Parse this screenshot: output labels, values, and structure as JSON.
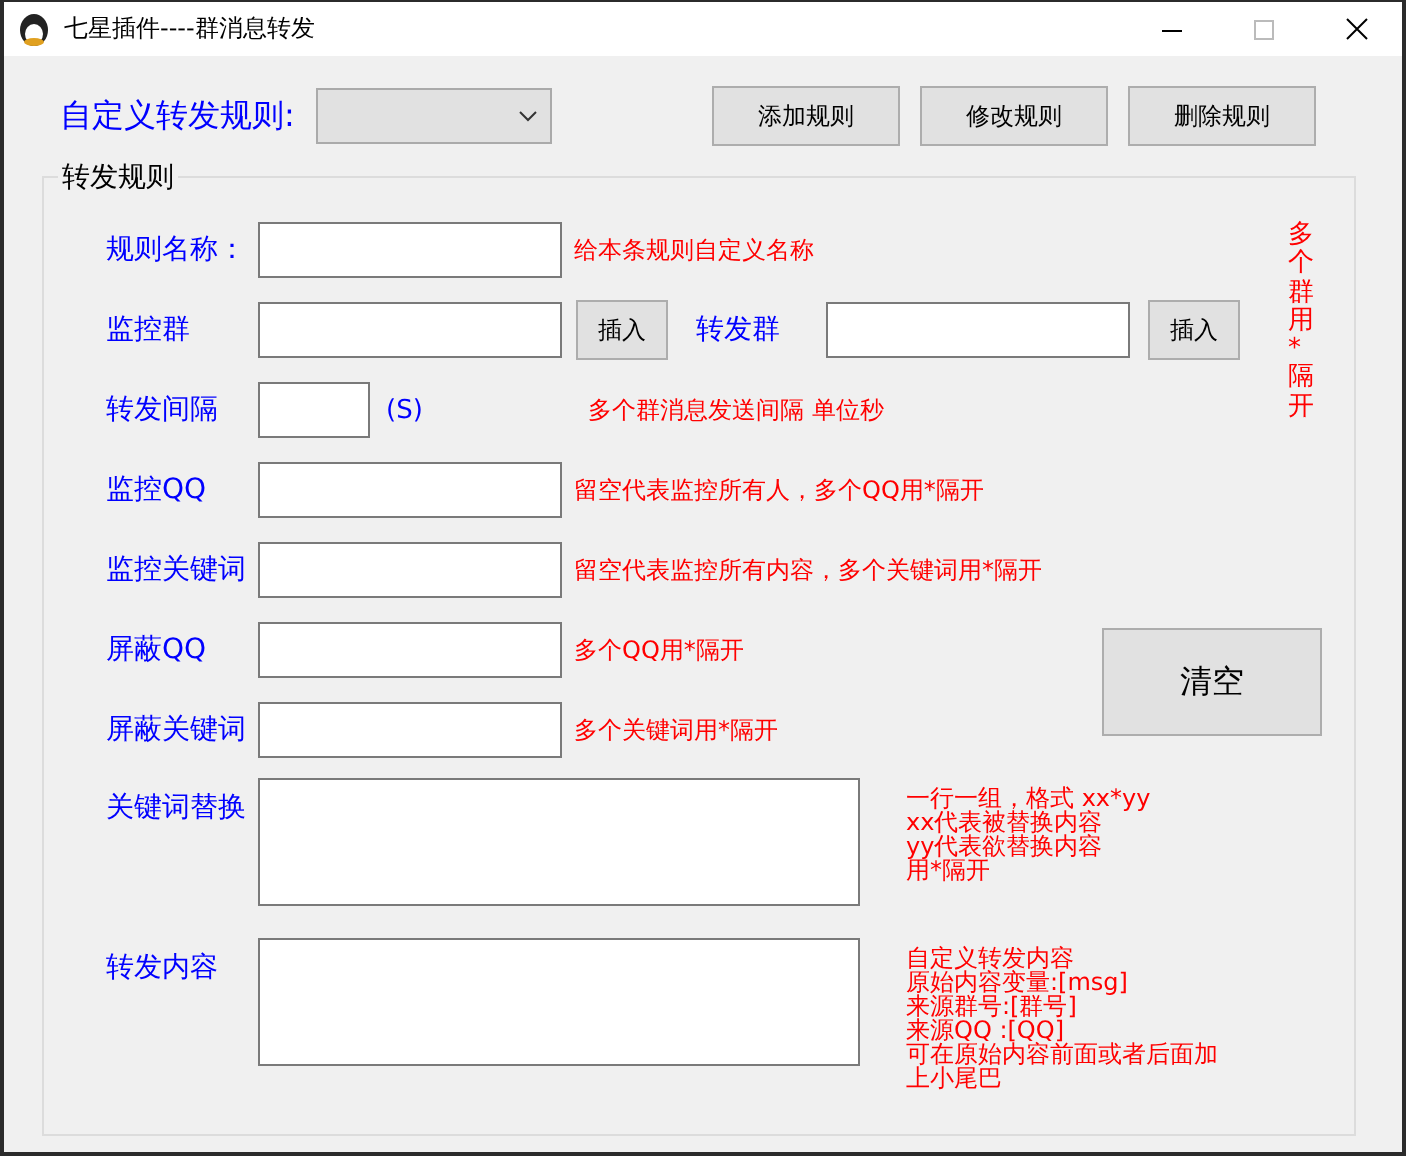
{
  "window": {
    "title": "七星插件----群消息转发"
  },
  "rule_select": {
    "label": "自定义转发规则:"
  },
  "buttons": [
    {
      "label": "添加规则"
    },
    {
      "label": "修改规则"
    },
    {
      "label": "删除规则"
    }
  ],
  "group": {
    "title": "转发规则",
    "side_note": "多个群用*隔开",
    "clear_button": "清空",
    "rows": [
      {
        "kind": "text",
        "label": "规则名称：",
        "hint": "给本条规则自定义名称"
      },
      {
        "kind": "pair",
        "label": "监控群",
        "button": "插入",
        "label_2": "转发群",
        "button_2": "插入"
      },
      {
        "kind": "interval",
        "label": "转发间隔",
        "unit": "(S)",
        "hint": "多个群消息发送间隔 单位秒"
      },
      {
        "kind": "text",
        "label": "监控QQ",
        "hint": "留空代表监控所有人，多个QQ用*隔开"
      },
      {
        "kind": "text",
        "label": "监控关键词",
        "hint": "留空代表监控所有内容，多个关键词用*隔开"
      },
      {
        "kind": "text",
        "label": "屏蔽QQ",
        "hint": "多个QQ用*隔开"
      },
      {
        "kind": "text",
        "label": "屏蔽关键词",
        "hint": "多个关键词用*隔开"
      },
      {
        "kind": "textarea",
        "label": "关键词替换",
        "hint_lines": [
          "一行一组，格式 xx*yy",
          "xx代表被替换内容",
          "yy代表欲替换内容",
          "用*隔开"
        ]
      },
      {
        "kind": "textarea",
        "label": "转发内容",
        "hint_lines": [
          "自定义转发内容",
          "原始内容变量:[msg]",
          "来源群号:[群号]",
          "来源QQ :[QQ]",
          "可在原始内容前面或者后面加",
          "上小尾巴"
        ]
      }
    ]
  }
}
